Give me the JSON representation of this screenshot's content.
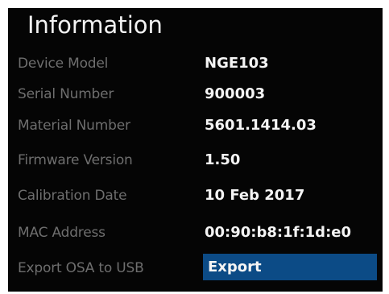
{
  "screen": {
    "title": "Information"
  },
  "info": {
    "device_model": {
      "label": "Device Model",
      "value": "NGE103"
    },
    "serial_number": {
      "label": "Serial Number",
      "value": "900003"
    },
    "material_number": {
      "label": "Material Number",
      "value": "5601.1414.03"
    },
    "firmware_version": {
      "label": "Firmware Version",
      "value": "1.50"
    },
    "calibration_date": {
      "label": "Calibration Date",
      "value": "10 Feb 2017"
    },
    "mac_address": {
      "label": "MAC Address",
      "value": "00:90:b8:1f:1d:e0"
    }
  },
  "export": {
    "label": "Export OSA to USB",
    "button_label": "Export",
    "button_color": "#0c4b86"
  },
  "colors": {
    "background": "#050505",
    "label_text": "#6e6e6e",
    "value_text": "#f4f4f4"
  }
}
